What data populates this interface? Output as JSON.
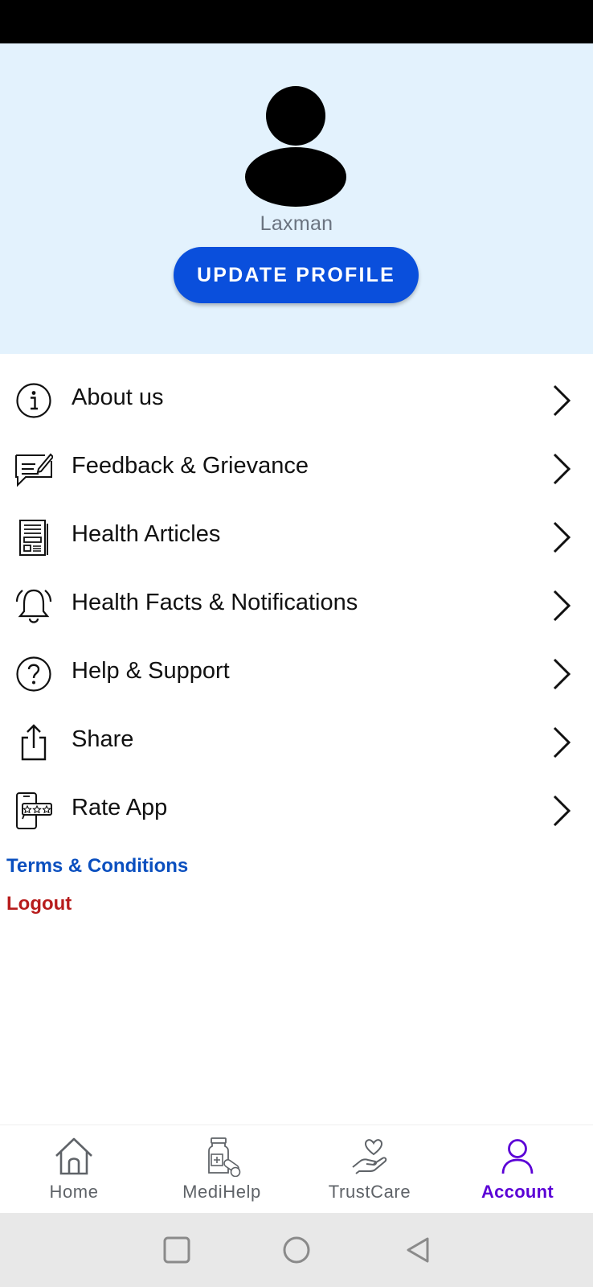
{
  "profile": {
    "user_name": "Laxman",
    "update_button_label": "UPDATE PROFILE"
  },
  "menu": {
    "items": [
      {
        "label": "About us",
        "icon": "info-icon"
      },
      {
        "label": "Feedback & Grievance",
        "icon": "feedback-icon"
      },
      {
        "label": "Health Articles",
        "icon": "article-icon"
      },
      {
        "label": "Health Facts & Notifications",
        "icon": "bell-icon"
      },
      {
        "label": "Help & Support",
        "icon": "help-icon"
      },
      {
        "label": "Share",
        "icon": "share-icon"
      },
      {
        "label": "Rate App",
        "icon": "rate-app-icon"
      }
    ]
  },
  "links": {
    "terms": "Terms & Conditions",
    "logout": "Logout"
  },
  "bottom_nav": {
    "items": [
      {
        "label": "Home",
        "icon": "home-icon",
        "active": false
      },
      {
        "label": "MediHelp",
        "icon": "medicine-icon",
        "active": false
      },
      {
        "label": "TrustCare",
        "icon": "care-hand-icon",
        "active": false
      },
      {
        "label": "Account",
        "icon": "account-icon",
        "active": true
      }
    ]
  },
  "colors": {
    "header_bg": "#e3f2fd",
    "primary_button": "#0a4fdc",
    "link_blue": "#0a4fbf",
    "logout_red": "#b71c1c",
    "nav_active": "#5b00d6"
  }
}
